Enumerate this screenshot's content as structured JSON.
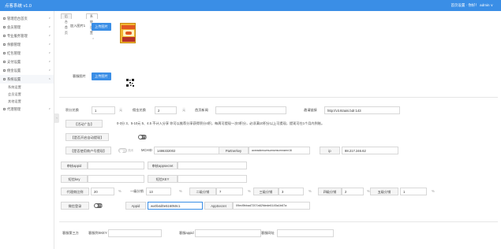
{
  "header": {
    "brand": "点客系统 v1.0",
    "user": "首页设置 · 你好！ admin ∨"
  },
  "sidebar": {
    "items": [
      {
        "label": "管理后台首页",
        "arrow": "∨"
      },
      {
        "label": "会员管理",
        "arrow": "∨"
      },
      {
        "label": "专业服务管理",
        "arrow": "∨"
      },
      {
        "label": "余额管理",
        "arrow": "∨"
      },
      {
        "label": "红包管理",
        "arrow": "∨"
      },
      {
        "label": "支付设置",
        "arrow": "∨"
      },
      {
        "label": "佣金设置",
        "arrow": "∨"
      },
      {
        "label": "系统设置",
        "arrow": "∧"
      }
    ],
    "sub_items": [
      "系统设置",
      "会员设置",
      "其他设置"
    ],
    "after_items": [
      {
        "label": "代理管理",
        "arrow": "∨"
      }
    ],
    "collapse_glyph": "‹"
  },
  "tabs": [
    {
      "label": "后台首页"
    },
    {
      "label": "系统设置",
      "close": "×"
    }
  ],
  "form": {
    "poster_label": "加入图片1",
    "upload_btn": "上传图片",
    "logo_label": "客服图片",
    "upload_btn2": "上传图片",
    "row1": {
      "l1": "积分兑换",
      "v1": "1",
      "u1": "元",
      "l2": "佣金兑换",
      "v2": "2",
      "u2": "元",
      "l3": "首页新闻",
      "l4": "邀请链接",
      "v4": "http://v3.92aini.bdr:143"
    },
    "row2": {
      "l1": "【活动广告】",
      "text": "0-3分 3、5-10元 5、4.5 不计入分享 你可以推荐分享获得积分4积，每周可提现一次0积分，必须满10积分以上可提现，提现可在1个月内到账。"
    },
    "row3": {
      "l1": "【是否开启自动提现】",
      "toggle": "开启"
    },
    "row4": {
      "l1": "【是否使用商户号提现】",
      "toggle": "关闭",
      "l2": "MCHID",
      "v2": "1486332002",
      "l3": "Partnerkey",
      "v3": "aonraokmuzmuzmzmnzmnzmn16",
      "l4": "ip",
      "v4": "88.217.246.62"
    },
    "row5": {
      "l1": "审核appid",
      "l2": "审核appsecret"
    },
    "row6": {
      "l1": "短信key",
      "l2": "短信KEY"
    },
    "row7": {
      "l1": "代理商比例",
      "v1": "20",
      "u1": "%",
      "l2": "一级分销",
      "v2": "13",
      "u2": "%",
      "l3": "二级分销",
      "v3": "7",
      "u3": "%",
      "l4": "三级分销",
      "v4": "3",
      "u4": "%",
      "l5": "四级分销",
      "v5": "2",
      "u5": "%",
      "l6": "五级分销",
      "v6": "1",
      "u6": "%"
    },
    "row8": {
      "l1": "微信登录",
      "toggle": "开启",
      "l2": "Appid",
      "v2": "wx0b4d0e516050c1",
      "l3": "AppSecret",
      "v3": "09ed9bbad7207a62fdede6145a1b67a"
    },
    "row9": {
      "l1": "客服第三方",
      "l2": "客服到SKEY",
      "l3": "客服appid",
      "l4": "客服网址"
    }
  }
}
